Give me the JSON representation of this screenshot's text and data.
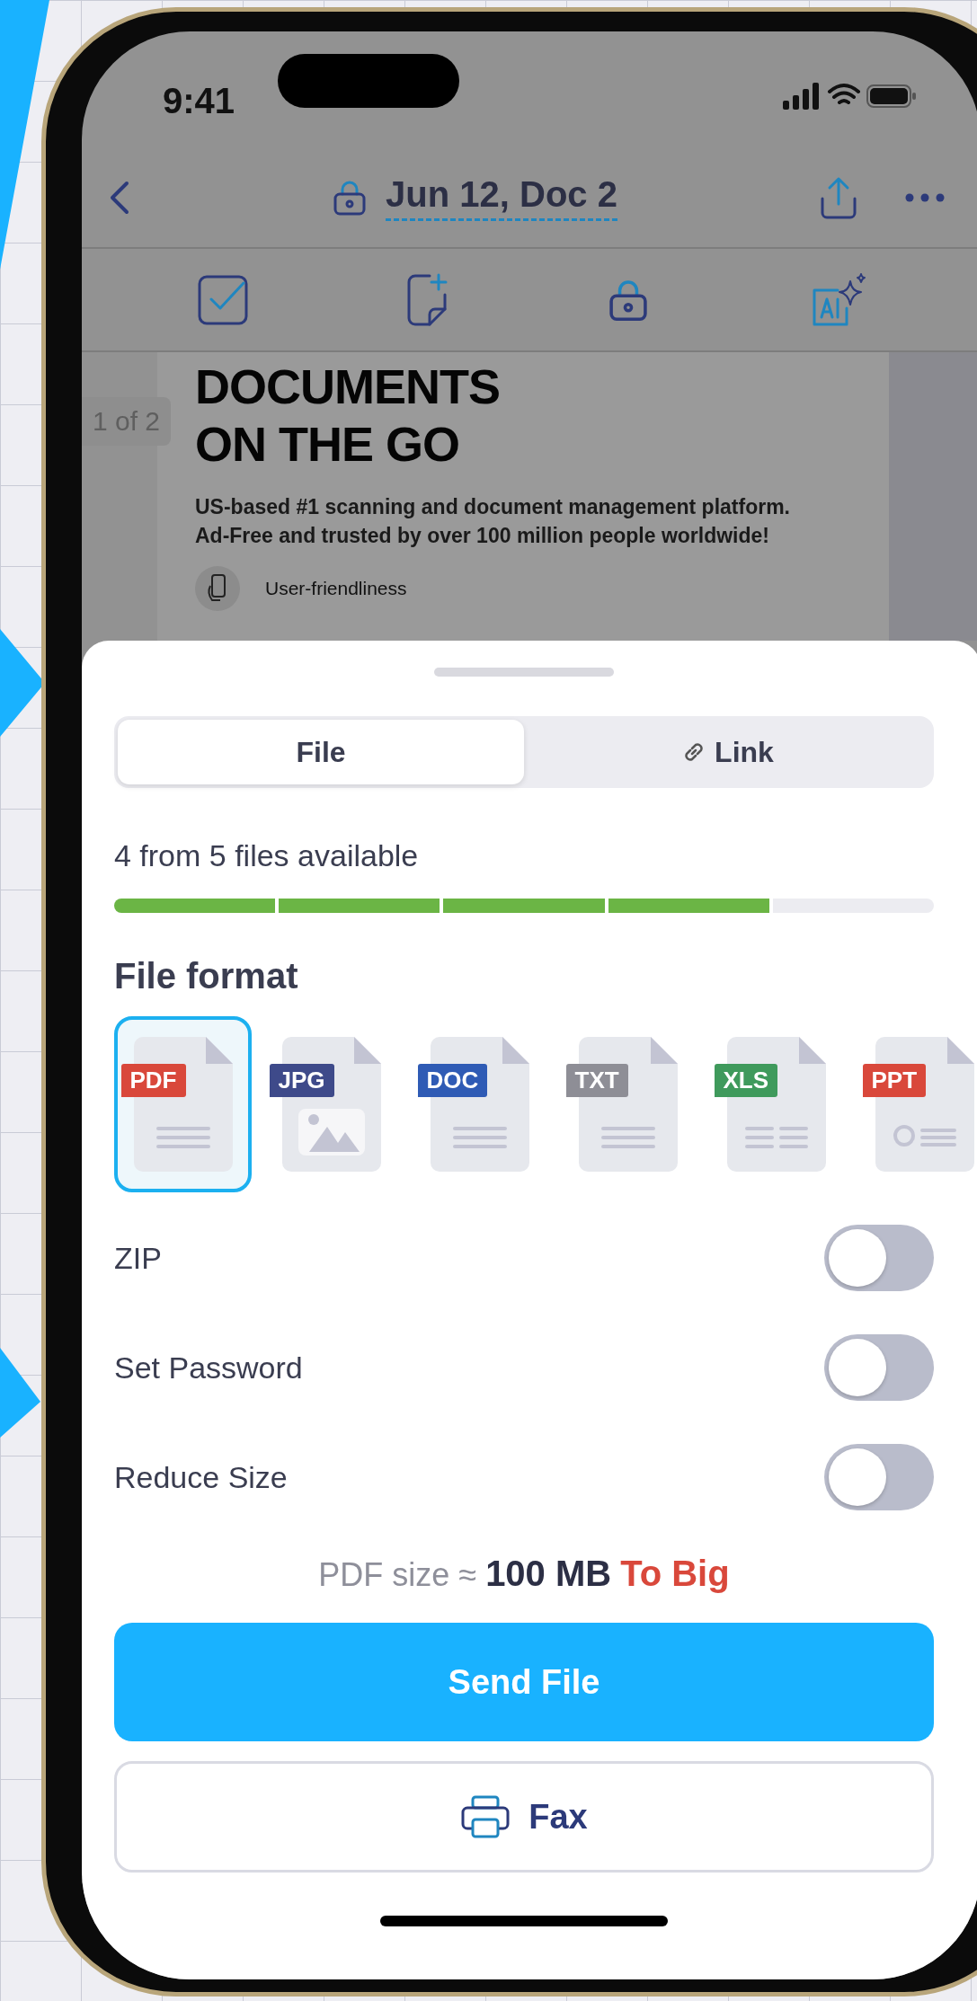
{
  "status_bar": {
    "time": "9:41"
  },
  "nav": {
    "title": "Jun 12, Doc 2"
  },
  "document": {
    "page_indicator": "1 of 2",
    "heading_lines": [
      "DOCUMENTS",
      "ON THE GO"
    ],
    "body_lines": [
      "US-based #1 scanning and document management platform.",
      "Ad-Free and trusted by over 100 million people worldwide!"
    ],
    "feature": "User-friendliness"
  },
  "share_sheet": {
    "tabs": [
      {
        "label": "File",
        "selected": true
      },
      {
        "label": "Link",
        "selected": false
      }
    ],
    "availability": "4 from 5 files available",
    "segments": [
      {
        "filled": true
      },
      {
        "filled": true
      },
      {
        "filled": true
      },
      {
        "filled": true
      },
      {
        "filled": false
      }
    ],
    "format_title": "File format",
    "formats": [
      {
        "label": "PDF",
        "color": "#d9483b",
        "kind": "lines",
        "selected": true
      },
      {
        "label": "JPG",
        "color": "#3e4a8a",
        "kind": "image",
        "selected": false
      },
      {
        "label": "DOC",
        "color": "#2f5bb5",
        "kind": "lines",
        "selected": false
      },
      {
        "label": "TXT",
        "color": "#8e8e96",
        "kind": "lines",
        "selected": false
      },
      {
        "label": "XLS",
        "color": "#3f9a5c",
        "kind": "table",
        "selected": false
      },
      {
        "label": "PPT",
        "color": "#d9483b",
        "kind": "slides",
        "selected": false
      }
    ],
    "options": [
      {
        "label": "ZIP",
        "on": false
      },
      {
        "label": "Set Password",
        "on": false
      },
      {
        "label": "Reduce Size",
        "on": false
      }
    ],
    "size_note": {
      "prefix": "PDF size ≈",
      "size": "100 MB",
      "warning": "To Big"
    },
    "send_button": "Send File",
    "fax_button": "Fax"
  }
}
